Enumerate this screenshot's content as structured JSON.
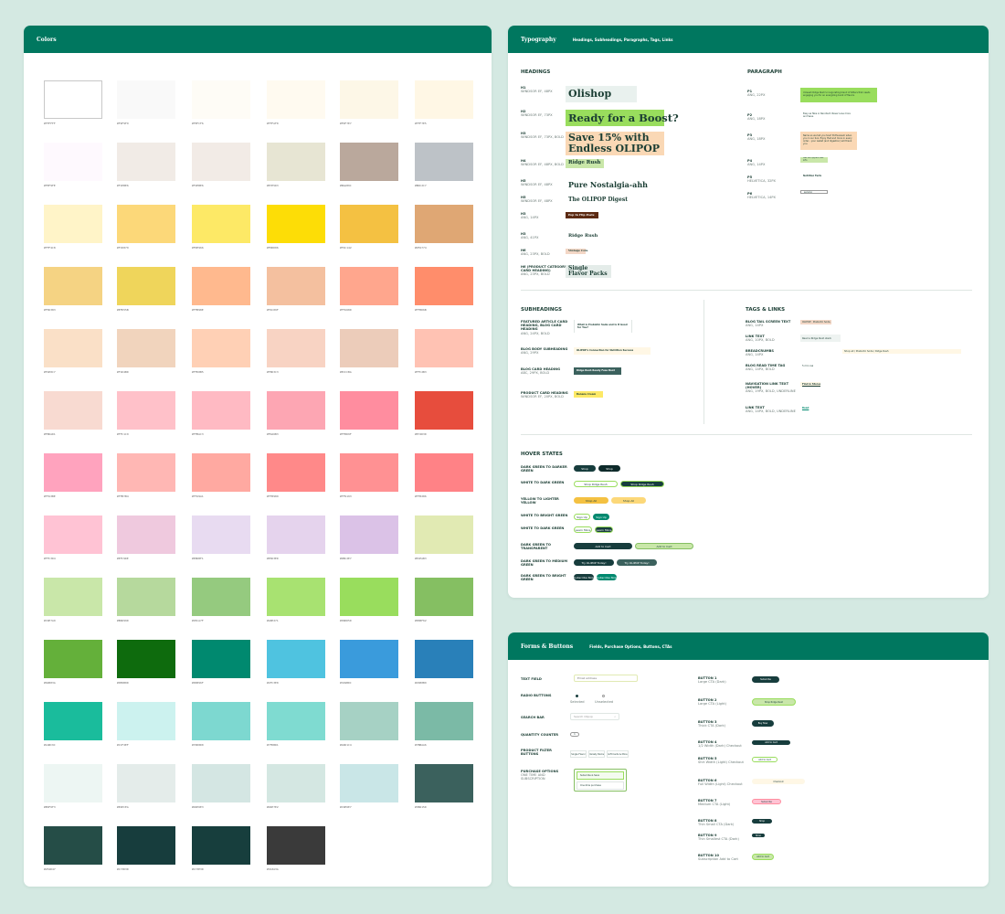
{
  "colors_card": {
    "title": "Colors",
    "swatches": [
      {
        "hex": "#FFFFFF"
      },
      {
        "hex": "#F9F9F9"
      },
      {
        "hex": "#FEFCF6"
      },
      {
        "hex": "#FFFAF0"
      },
      {
        "hex": "#FDF7E7"
      },
      {
        "hex": "#FFF7E5"
      },
      {
        "hex": "#FEF9FE"
      },
      {
        "hex": "#F1EBE6"
      },
      {
        "hex": "#F2EBE6"
      },
      {
        "hex": "#E7E5D3"
      },
      {
        "hex": "#BAA89C"
      },
      {
        "hex": "#BDC2C7"
      },
      {
        "hex": "#FFF4C8"
      },
      {
        "hex": "#FCD879"
      },
      {
        "hex": "#FDE966"
      },
      {
        "hex": "#FDDD06"
      },
      {
        "hex": "#F4C142"
      },
      {
        "hex": "#DFA774"
      },
      {
        "hex": "#F5D383"
      },
      {
        "hex": "#EFD55B"
      },
      {
        "hex": "#FFB98E"
      },
      {
        "hex": "#F4C09F"
      },
      {
        "hex": "#FFA68D"
      },
      {
        "hex": "#FF8D6B"
      },
      {
        "hex": "#FAE0C7"
      },
      {
        "hex": "#F1D4BD"
      },
      {
        "hex": "#FFD0B5"
      },
      {
        "hex": "#F8D3C3"
      },
      {
        "hex": "#ECCCBA"
      },
      {
        "hex": "#FFC2B3"
      },
      {
        "hex": "#F8DAD1"
      },
      {
        "hex": "#FFC1C9"
      },
      {
        "hex": "#FFBAC3"
      },
      {
        "hex": "#FDA6B3"
      },
      {
        "hex": "#FF8D9F"
      },
      {
        "hex": "#E74D3D"
      },
      {
        "hex": "#FFA3BE"
      },
      {
        "hex": "#FFB7B4"
      },
      {
        "hex": "#FFA9A1"
      },
      {
        "hex": "#FF8989"
      },
      {
        "hex": "#FF9193"
      },
      {
        "hex": "#FF8286"
      },
      {
        "hex": "#FFC3D4"
      },
      {
        "hex": "#EFC9DE"
      },
      {
        "hex": "#E8DBF1"
      },
      {
        "hex": "#E5D3ED"
      },
      {
        "hex": "#DBC2E7"
      },
      {
        "hex": "#E1EAB3"
      },
      {
        "hex": "#C9E7A9"
      },
      {
        "hex": "#B6D99D"
      },
      {
        "hex": "#95CA7F"
      },
      {
        "hex": "#A8E271"
      },
      {
        "hex": "#99DD5D"
      },
      {
        "hex": "#85BF62"
      },
      {
        "hex": "#64B03A"
      },
      {
        "hex": "#0E6B0D"
      },
      {
        "hex": "#00896F"
      },
      {
        "hex": "#4FC3E0"
      },
      {
        "hex": "#3A9BDC"
      },
      {
        "hex": "#2980B9"
      },
      {
        "hex": "#1ABC9C"
      },
      {
        "hex": "#CCF2EF"
      },
      {
        "hex": "#7DD8D0"
      },
      {
        "hex": "#7FDBD1"
      },
      {
        "hex": "#A6D1C4"
      },
      {
        "hex": "#7BBAA6"
      },
      {
        "hex": "#EDF6F3"
      },
      {
        "hex": "#E4ECEA"
      },
      {
        "hex": "#D4E6E3"
      },
      {
        "hex": "#D4E7E2"
      },
      {
        "hex": "#C9E6E7"
      },
      {
        "hex": "#3B615D"
      },
      {
        "hex": "#254D47"
      },
      {
        "hex": "#173D3D"
      },
      {
        "hex": "#173E3D"
      },
      {
        "hex": "#3A3A3A"
      }
    ]
  },
  "typography_card": {
    "title": "Typography",
    "subtitle": "Headings, Subheadings, Paragraphs, Tags, Links",
    "headings": {
      "title": "HEADINGS",
      "rows": [
        {
          "label": "H1",
          "spec": "WINDSOR EF, 48PX",
          "sample": "Olishop",
          "bg": "#e9f1ee"
        },
        {
          "label": "H2",
          "spec": "WINDSOR EF, 73PX",
          "sample": "Ready for a Boost?",
          "bg": "#99dd5d"
        },
        {
          "label": "H3",
          "spec": "WINDSOR EF, 73PX, BOLD",
          "sample": "Save 15% with Endless OLIPOP",
          "bg": "#fad8b5"
        },
        {
          "label": "H4",
          "spec": "WINDSOR EF, 48PX, BOLD",
          "sample": "Ridge Rush",
          "bg": "#c9e7a9"
        },
        {
          "label": "H5",
          "spec": "WINDSOR EF, 48PX",
          "sample": "Pure Nostalgia-ahh",
          "bg": "#ffffff"
        },
        {
          "label": "H5",
          "spec": "WINDSOR EF, 48PX",
          "sample": "The OLIPOP Digest",
          "bg": "#ffffff"
        },
        {
          "label": "H3",
          "spec": "ANG, 14PX",
          "sample": "Pop In Flip Posts",
          "bg": "#5c2a12"
        },
        {
          "label": "H3",
          "spec": "ANG, 41PX",
          "sample": "Ridge Rush",
          "bg": "#ffffff"
        },
        {
          "label": "H6",
          "spec": "ANG, 23PX, BOLD",
          "sample": "Vintage Cola",
          "bg": "#f3d7c6"
        },
        {
          "label": "H6 (PRODUCT CATEGORY CARD HEADING)",
          "spec": "ANG, 23PX, BOLD",
          "sample": "Single Flavor Packs",
          "bg": "#e4ece9"
        }
      ]
    },
    "paragraph": {
      "title": "PARAGRAPH",
      "rows": [
        {
          "label": "P1",
          "spec": "ANG, 22PX",
          "sample": "Unleash Ridge Rush's invigorating blend of bitters that needs engaging you for an energizing burst of flavors",
          "bg": "#99dd5d"
        },
        {
          "label": "P2",
          "spec": "ANG, 18PX",
          "sample": "Easy as Take or Recollect. Never Lose more and Save.",
          "bg": "#ffffff"
        },
        {
          "label": "P3",
          "spec": "ANG, 18PX",
          "sample": "Name so we tell you how? Enthusiasm when you in our box. Enjoy that and more in every order - your wallet (and digestion) will thank you.",
          "bg": "#fad8b5"
        },
        {
          "label": "P4",
          "spec": "ANG, 14PX",
          "sample": "Get as flippers Get info",
          "bg": "#c9e7a9"
        },
        {
          "label": "P5",
          "spec": "HELVETICA, 32PX",
          "sample": "Nutrition Facts",
          "bg": "#ffffff"
        },
        {
          "label": "P6",
          "spec": "HELVETICA, 14PX",
          "sample": "Amount per serving",
          "bg": "#ffffff"
        }
      ]
    },
    "subheadings": {
      "title": "SUBHEADINGS",
      "rows": [
        {
          "label": "FEATURED ARTICLE CARD HEADING, BLOG CARD HEADING",
          "spec": "ANG, 24PX, BOLD",
          "sample": "What is Prebiotic Soda and Is It Good for You?",
          "bg": "#ffffff"
        },
        {
          "label": "BLOG BODY SUBHEADING",
          "spec": "ANG, 29PX",
          "sample": "OLIPOP's Connection for Nutrition Success",
          "bg": "#fff7e5"
        },
        {
          "label": "BLOG CARD HEADING",
          "spec": "ABC, 29PX, BOLD",
          "sample": "Ridge Rush Ready Fuse Boot",
          "bg": "#3b615d"
        },
        {
          "label": "PRODUCT CARD HEADING",
          "spec": "WINDSOR EF, 20PX, BOLD",
          "sample": "Banana Cream",
          "bg": "#fde966"
        }
      ]
    },
    "tags_links": {
      "title": "TAGS & LINKS",
      "rows": [
        {
          "label": "BLOG TAIL SCREEN TEXT",
          "spec": "ANG, 14PX",
          "sample": "OLIPOP · Prebiotic Soda · Nutrition",
          "bg": "#f3d7c6"
        },
        {
          "label": "LINK TEXT",
          "spec": "ANG, 10PX, BOLD",
          "sample": "Read a Ridge Rush stack",
          "bg": "#eef3f1"
        },
        {
          "label": "BREADCRUMBS",
          "spec": "ANG, 14PX",
          "sample": "Shop all / Prebiotic Soda / Ridge Rush",
          "bg": "#fff7e5"
        },
        {
          "label": "BLOG READ TIME TAG",
          "spec": "ANG, 14PX, BOLD",
          "sample": "5 min read",
          "bg": "#ffffff"
        },
        {
          "label": "NAVIGATION LINK TEXT (HOVER)",
          "spec": "ANG, 19PX, BOLD, UNDERLINE",
          "sample": "Find in Stores",
          "bg": "#fff7e5"
        },
        {
          "label": "LINK TEXT",
          "spec": "ANG, 14PX, BOLD, UNDERLINE",
          "sample": "Read",
          "bg": "#ffffff"
        }
      ]
    },
    "hover": {
      "title": "HOVER STATES",
      "rows": [
        {
          "label": "DARK GREEN TO DARKER GREEN",
          "a": "Shop",
          "b": "Shop",
          "a_bg": "#173d3d",
          "b_bg": "#0d2a2a",
          "a_fg": "#ffffff",
          "b_fg": "#ffffff"
        },
        {
          "label": "WHITE TO DARK GREEN",
          "a": "Shop Ridge Rush",
          "b": "Shop Ridge Rush",
          "a_bg": "#ffffff",
          "b_bg": "#173d3d",
          "a_fg": "#173d3d",
          "b_fg": "#ffffff"
        },
        {
          "label": "YELLOW TO LIGHTER YELLOW",
          "a": "Shop All",
          "b": "Shop All",
          "a_bg": "#f4c142",
          "b_bg": "#fcd879",
          "a_fg": "#173d3d",
          "b_fg": "#173d3d"
        },
        {
          "label": "WHITE TO BRIGHT GREEN",
          "a": "Sign Up",
          "b": "Sign Up",
          "a_bg": "#ffffff",
          "b_bg": "#00896f",
          "a_fg": "#173d3d",
          "b_fg": "#ffffff"
        },
        {
          "label": "WHITE TO DARK GREEN",
          "a": "Learn More",
          "b": "Learn More",
          "a_bg": "#ffffff",
          "b_bg": "#173d3d",
          "a_fg": "#173d3d",
          "b_fg": "#ffffff"
        },
        {
          "label": "DARK GREEN TO TRANSPARENT",
          "a": "Add to Cart",
          "b": "Add to Cart",
          "a_bg": "#173d3d",
          "b_bg": "#c9e7a9",
          "a_fg": "#ffffff",
          "b_fg": "#173d3d"
        },
        {
          "label": "DARK GREEN TO MEDIUM GREEN",
          "a": "Try OLIPOP Today!",
          "b": "Try OLIPOP Today!",
          "a_bg": "#173d3d",
          "b_bg": "#3b615d",
          "a_fg": "#ffffff",
          "b_fg": "#ffffff"
        },
        {
          "label": "DARK GREEN TO BRIGHT GREEN",
          "a": "Subscribe Now",
          "b": "Subscribe Now",
          "a_bg": "#173d3d",
          "b_bg": "#00896f",
          "a_fg": "#ffffff",
          "b_fg": "#ffffff"
        }
      ]
    }
  },
  "forms_card": {
    "title": "Forms & Buttons",
    "subtitle": "Fields, Purchase Options, Buttons, CTAs",
    "text_field": {
      "label": "TEXT FIELD",
      "placeholder": "Email address"
    },
    "radio": {
      "label": "RADIO BUTTONS",
      "selected": "Selected",
      "unselected": "Unselected"
    },
    "search": {
      "label": "SEARCH BAR",
      "placeholder": "Search Olipop"
    },
    "quantity": {
      "label": "QUANTITY COUNTER",
      "value": "1"
    },
    "filters": {
      "label": "PRODUCT FILTER BUTTONS",
      "options": [
        "Single Flavor",
        "Variety Packs",
        "Gift Cards & More"
      ]
    },
    "purchase": {
      "label": "PURCHASE OPTIONS",
      "spec": "ONE TIME AND SUBSCRIPTION",
      "option_a": "Subscribe & Save",
      "option_b": "One-time purchase"
    },
    "buttons": [
      {
        "label": "BUTTON 1",
        "spec": "Large CTA (Dark)",
        "text": "Subscribe",
        "bg": "#173d3d",
        "fg": "#ffffff",
        "border": "#173d3d"
      },
      {
        "label": "BUTTON 2",
        "spec": "Large CTA (Light)",
        "text": "Shop Ridge Rush",
        "bg": "#c9e7a9",
        "fg": "#173d3d",
        "border": "#99dd5d"
      },
      {
        "label": "BUTTON 3",
        "spec": "Thick CTA (Dark)",
        "text": "Buy Now",
        "bg": "#173d3d",
        "fg": "#ffffff",
        "border": "#173d3d"
      },
      {
        "label": "BUTTON 4",
        "spec": "1/2 Width (Dark) Checkout",
        "text": "Add to Cart",
        "bg": "#173d3d",
        "fg": "#ffffff",
        "border": "#173d3d"
      },
      {
        "label": "BUTTON 5",
        "spec": "Shrt Width (Light) Checkout",
        "text": "Add to Cart",
        "bg": "#ffffff",
        "fg": "#173d3d",
        "border": "#99dd5d"
      },
      {
        "label": "BUTTON 6",
        "spec": "Full Width (Light) Checkout",
        "text": "Checkout",
        "bg": "#fff7e5",
        "fg": "#173d3d",
        "border": "#fdf7e7"
      },
      {
        "label": "BUTTON 7",
        "spec": "Medium CTA (Light)",
        "text": "Subscribe",
        "bg": "#ffc3d4",
        "fg": "#173d3d",
        "border": "#ff8d9f"
      },
      {
        "label": "BUTTON 8",
        "spec": "Thin Small CTA (Dark)",
        "text": "Shop",
        "bg": "#173d3d",
        "fg": "#ffffff",
        "border": "#173d3d"
      },
      {
        "label": "BUTTON 9",
        "spec": "Thin Smallest CTA (Dark)",
        "text": "Shop",
        "bg": "#173d3d",
        "fg": "#ffffff",
        "border": "#173d3d"
      },
      {
        "label": "BUTTON 10",
        "spec": "Subscription Add to Cart",
        "text": "Add to Cart",
        "bg": "#c9e7a9",
        "fg": "#173d3d",
        "border": "#99dd5d"
      }
    ]
  }
}
